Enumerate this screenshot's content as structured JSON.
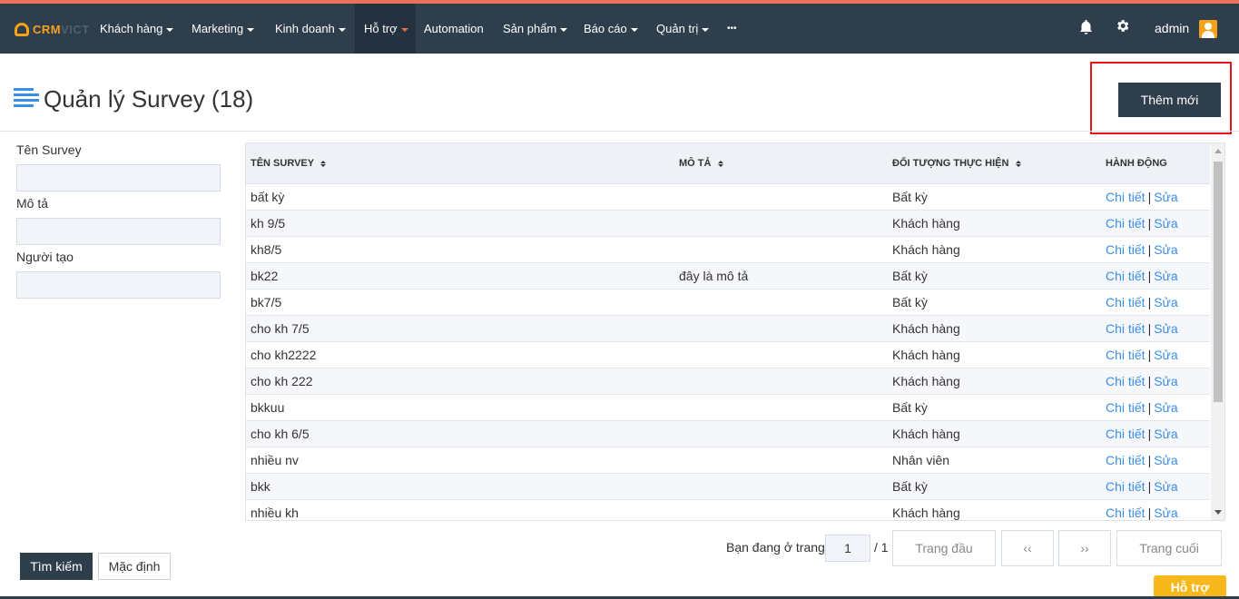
{
  "brand": {
    "part1": "CRM",
    "part2": "VICT"
  },
  "nav": {
    "items": [
      {
        "label": "Khách hàng"
      },
      {
        "label": "Marketing"
      },
      {
        "label": "Kinh doanh"
      },
      {
        "label": "Hỗ trợ"
      },
      {
        "label": "Automation"
      },
      {
        "label": "Sản phẩm"
      },
      {
        "label": "Báo cáo"
      },
      {
        "label": "Quản trị"
      },
      {
        "label": "•••"
      }
    ],
    "active": "Hỗ trợ",
    "user": "admin"
  },
  "page": {
    "title": "Quản lý Survey (18)",
    "add_button": "Thêm mới"
  },
  "filters": {
    "name_label": "Tên Survey",
    "desc_label": "Mô tả",
    "creator_label": "Người tạo",
    "name_value": "",
    "desc_value": "",
    "creator_value": "",
    "search_button": "Tìm kiếm",
    "default_button": "Mặc định"
  },
  "table": {
    "headers": {
      "name": "TÊN SURVEY",
      "desc": "MÔ TẢ",
      "target": "ĐỐI TƯỢNG THỰC HIỆN",
      "action": "HÀNH ĐỘNG"
    },
    "action_detail": "Chi tiết",
    "action_sep": "|",
    "action_edit": "Sửa",
    "rows": [
      {
        "name": "bất kỳ",
        "desc": "",
        "target": "Bất kỳ"
      },
      {
        "name": "kh 9/5",
        "desc": "",
        "target": "Khách hàng"
      },
      {
        "name": "kh8/5",
        "desc": "",
        "target": "Khách hàng"
      },
      {
        "name": "bk22",
        "desc": "đây là mô tả",
        "target": "Bất kỳ"
      },
      {
        "name": "bk7/5",
        "desc": "",
        "target": "Bất kỳ"
      },
      {
        "name": "cho kh 7/5",
        "desc": "",
        "target": "Khách hàng"
      },
      {
        "name": "cho kh2222",
        "desc": "",
        "target": "Khách hàng"
      },
      {
        "name": "cho kh 222",
        "desc": "",
        "target": "Khách hàng"
      },
      {
        "name": "bkkuu",
        "desc": "",
        "target": "Bất kỳ"
      },
      {
        "name": "cho kh 6/5",
        "desc": "",
        "target": "Khách hàng"
      },
      {
        "name": "nhiều nv",
        "desc": "",
        "target": "Nhân viên"
      },
      {
        "name": "bkk",
        "desc": "",
        "target": "Bất kỳ"
      },
      {
        "name": "nhiều kh",
        "desc": "",
        "target": "Khách hàng"
      }
    ]
  },
  "pager": {
    "prefix": "Bạn đang ở trang",
    "current": "1",
    "total": "/ 1",
    "first": "Trang đầu",
    "prev": "‹‹",
    "next": "››",
    "last": "Trang cuối"
  },
  "support_tab": "Hỗ trợ",
  "colors": {
    "navbar": "#2f3e4d",
    "accent_orange": "#f7a21b",
    "link_blue": "#3a8ee6",
    "highlight_red": "#e8141b"
  }
}
